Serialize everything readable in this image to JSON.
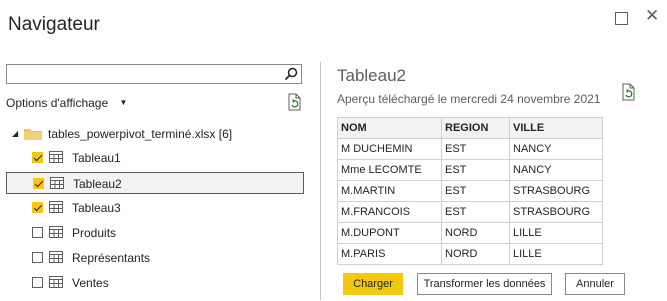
{
  "window": {
    "title": "Navigateur"
  },
  "colors": {
    "accent": "#f2c811",
    "text": "#252423",
    "muted": "#605e5c",
    "border": "#d2d0ce"
  },
  "left": {
    "search": {
      "value": "",
      "placeholder": ""
    },
    "options_label": "Options d'affichage",
    "tree": {
      "root_label": "tables_powerpivot_terminé.xlsx [6]",
      "items": [
        {
          "label": "Tableau1",
          "checked": true,
          "selected": false
        },
        {
          "label": "Tableau2",
          "checked": true,
          "selected": true
        },
        {
          "label": "Tableau3",
          "checked": true,
          "selected": false
        },
        {
          "label": "Produits",
          "checked": false,
          "selected": false
        },
        {
          "label": "Représentants",
          "checked": false,
          "selected": false
        },
        {
          "label": "Ventes",
          "checked": false,
          "selected": false
        }
      ]
    }
  },
  "preview": {
    "title": "Tableau2",
    "subtitle": "Aperçu téléchargé le mercredi 24 novembre 2021",
    "columns": [
      "NOM",
      "REGION",
      "VILLE"
    ],
    "rows": [
      [
        "M DUCHEMIN",
        "EST",
        "NANCY"
      ],
      [
        "Mme LECOMTE",
        "EST",
        "NANCY"
      ],
      [
        "M.MARTIN",
        "EST",
        "STRASBOURG"
      ],
      [
        "M.FRANCOIS",
        "EST",
        "STRASBOURG"
      ],
      [
        "M.DUPONT",
        "NORD",
        "LILLE"
      ],
      [
        "M.PARIS",
        "NORD",
        "LILLE"
      ]
    ]
  },
  "buttons": {
    "load": "Charger",
    "transform": "Transformer les données",
    "cancel": "Annuler"
  }
}
